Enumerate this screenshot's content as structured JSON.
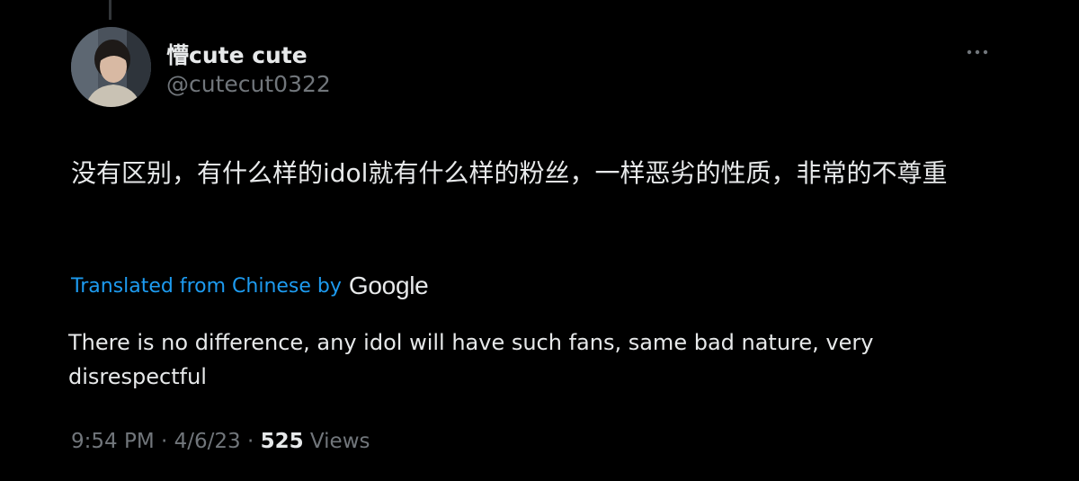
{
  "colors": {
    "background": "#000000",
    "text_primary": "#e7e9ea",
    "text_secondary": "#71767b",
    "link": "#1d9bf0",
    "thread_line": "#333639"
  },
  "author": {
    "display_name": "懵cute cute",
    "handle": "@cutecut0322",
    "avatar_icon": "user-avatar"
  },
  "tweet": {
    "text": "没有区别，有什么样的idol就有什么样的粉丝，一样恶劣的性质，非常的不尊重"
  },
  "translation": {
    "link_label": "Translated from Chinese by",
    "provider": "Google",
    "text": "There is no difference, any idol will have such fans, same bad nature, very disrespectful"
  },
  "meta": {
    "time": "9:54 PM",
    "separator1": " · ",
    "date": "4/6/23",
    "separator2": " · ",
    "views_count": "525",
    "views_label": " Views"
  },
  "icons": {
    "more": "more-horizontal-icon"
  }
}
